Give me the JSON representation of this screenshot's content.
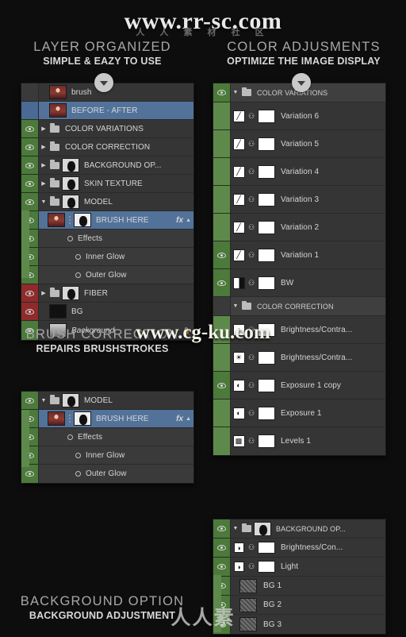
{
  "watermarks": {
    "top": "www.rr-sc.com",
    "middle": "www.cg-ku.com",
    "bottom": "人人素",
    "strip": "人 人 素 材 社 区"
  },
  "sections": {
    "layer_organized": {
      "title": "LAYER  ORGANIZED",
      "subtitle": "SIMPLE & EAZY TO USE"
    },
    "color_adjusments": {
      "title": "COLOR ADJUSMENTS",
      "subtitle": "OPTIMIZE THE IMAGE DISPLAY"
    },
    "brush_correction": {
      "title": "BRUSH CORRECTION",
      "subtitle": "REPAIRS BRUSHSTROKES"
    },
    "background_option": {
      "title": "BACKGROUND OPTION",
      "subtitle": "BACKGROUND ADJUSTMENT"
    }
  },
  "layers_panel": {
    "rows": [
      {
        "label": "brush",
        "eye": "off",
        "thumb": "portrait",
        "type": "layer"
      },
      {
        "label": "BEFORE - AFTER",
        "eye": "off",
        "thumb": "portrait",
        "type": "layer",
        "selected": true
      },
      {
        "label": "COLOR VARIATIONS",
        "eye": "green",
        "thumb": "folder",
        "type": "group"
      },
      {
        "label": "COLOR CORRECTION",
        "eye": "green",
        "thumb": "folder",
        "type": "group"
      },
      {
        "label": "BACKGROUND OP...",
        "eye": "green",
        "thumb": "folder",
        "type": "group",
        "mask": true
      },
      {
        "label": "SKIN TEXTURE",
        "eye": "green",
        "thumb": "folder",
        "type": "group",
        "mask": true
      },
      {
        "label": "MODEL",
        "eye": "green",
        "thumb": "folder",
        "type": "group",
        "mask": true,
        "open": true
      },
      {
        "label": "BRUSH HERE",
        "eye": "green",
        "thumb": "portrait",
        "type": "layer",
        "selected": true,
        "fx": "fx",
        "mask": true
      },
      {
        "label": "Effects",
        "type": "effects"
      },
      {
        "label": "Inner Glow",
        "type": "effect-item"
      },
      {
        "label": "Outer Glow",
        "type": "effect-item"
      },
      {
        "label": "FIBER",
        "eye": "red",
        "thumb": "folder",
        "type": "group",
        "mask": true
      },
      {
        "label": "BG",
        "eye": "red",
        "thumb": "black",
        "type": "layer"
      },
      {
        "label": "Background",
        "eye": "green",
        "thumb": "gray",
        "type": "layer",
        "italic": true,
        "locked": true
      }
    ]
  },
  "brush_panel": {
    "rows": [
      {
        "label": "MODEL",
        "eye": "green",
        "type": "group",
        "open": true,
        "mask": true
      },
      {
        "label": "BRUSH HERE",
        "eye": "green",
        "type": "layer",
        "selected": true,
        "fx": "fx",
        "mask": true
      },
      {
        "label": "Effects",
        "type": "effects"
      },
      {
        "label": "Inner Glow",
        "type": "effect-item"
      },
      {
        "label": "Outer Glow",
        "type": "effect-item"
      }
    ]
  },
  "color_panel": {
    "rows": [
      {
        "label": "COLOR VARIATIONS",
        "type": "group",
        "eye": "green",
        "open": true
      },
      {
        "label": "Variation 6",
        "type": "adj",
        "icon": "curves-icon",
        "eye": "off"
      },
      {
        "label": "Variation 5",
        "type": "adj",
        "icon": "curves-icon",
        "eye": "off"
      },
      {
        "label": "Variation 4",
        "type": "adj",
        "icon": "curves-icon",
        "eye": "off"
      },
      {
        "label": "Variation 3",
        "type": "adj",
        "icon": "curves-icon",
        "eye": "off"
      },
      {
        "label": "Variation 2",
        "type": "adj",
        "icon": "curves-icon",
        "eye": "off"
      },
      {
        "label": "Variation 1",
        "type": "adj",
        "icon": "curves-icon",
        "eye": "green"
      },
      {
        "label": "BW",
        "type": "adj",
        "icon": "black-white-icon",
        "eye": "green"
      },
      {
        "label": "COLOR CORRECTION",
        "type": "group",
        "eye": "off",
        "open": true
      },
      {
        "label": "Brightness/Contra...",
        "type": "adj",
        "icon": "brightness-icon",
        "eye": "off"
      },
      {
        "label": "Brightness/Contra...",
        "type": "adj",
        "icon": "sun-icon",
        "eye": "off"
      },
      {
        "label": "Exposure 1 copy",
        "type": "adj",
        "icon": "exposure-icon",
        "eye": "green"
      },
      {
        "label": "Exposure 1",
        "type": "adj",
        "icon": "exposure-icon",
        "eye": "off"
      },
      {
        "label": "Levels 1",
        "type": "adj",
        "icon": "levels-icon",
        "eye": "off"
      }
    ]
  },
  "background_panel": {
    "rows": [
      {
        "label": "BACKGROUND OP...",
        "type": "group",
        "eye": "green",
        "open": true,
        "mask": true
      },
      {
        "label": "Brightness/Con...",
        "type": "adj",
        "icon": "brightness-icon",
        "eye": "green"
      },
      {
        "label": "Light",
        "type": "adj",
        "icon": "brightness-icon",
        "eye": "off"
      },
      {
        "label": "BG 1",
        "type": "layer",
        "eye": "green",
        "thumb": "noise"
      },
      {
        "label": "BG 2",
        "type": "layer",
        "eye": "green",
        "thumb": "noise"
      },
      {
        "label": "BG 3",
        "type": "layer",
        "eye": "green",
        "thumb": "noise"
      }
    ]
  }
}
